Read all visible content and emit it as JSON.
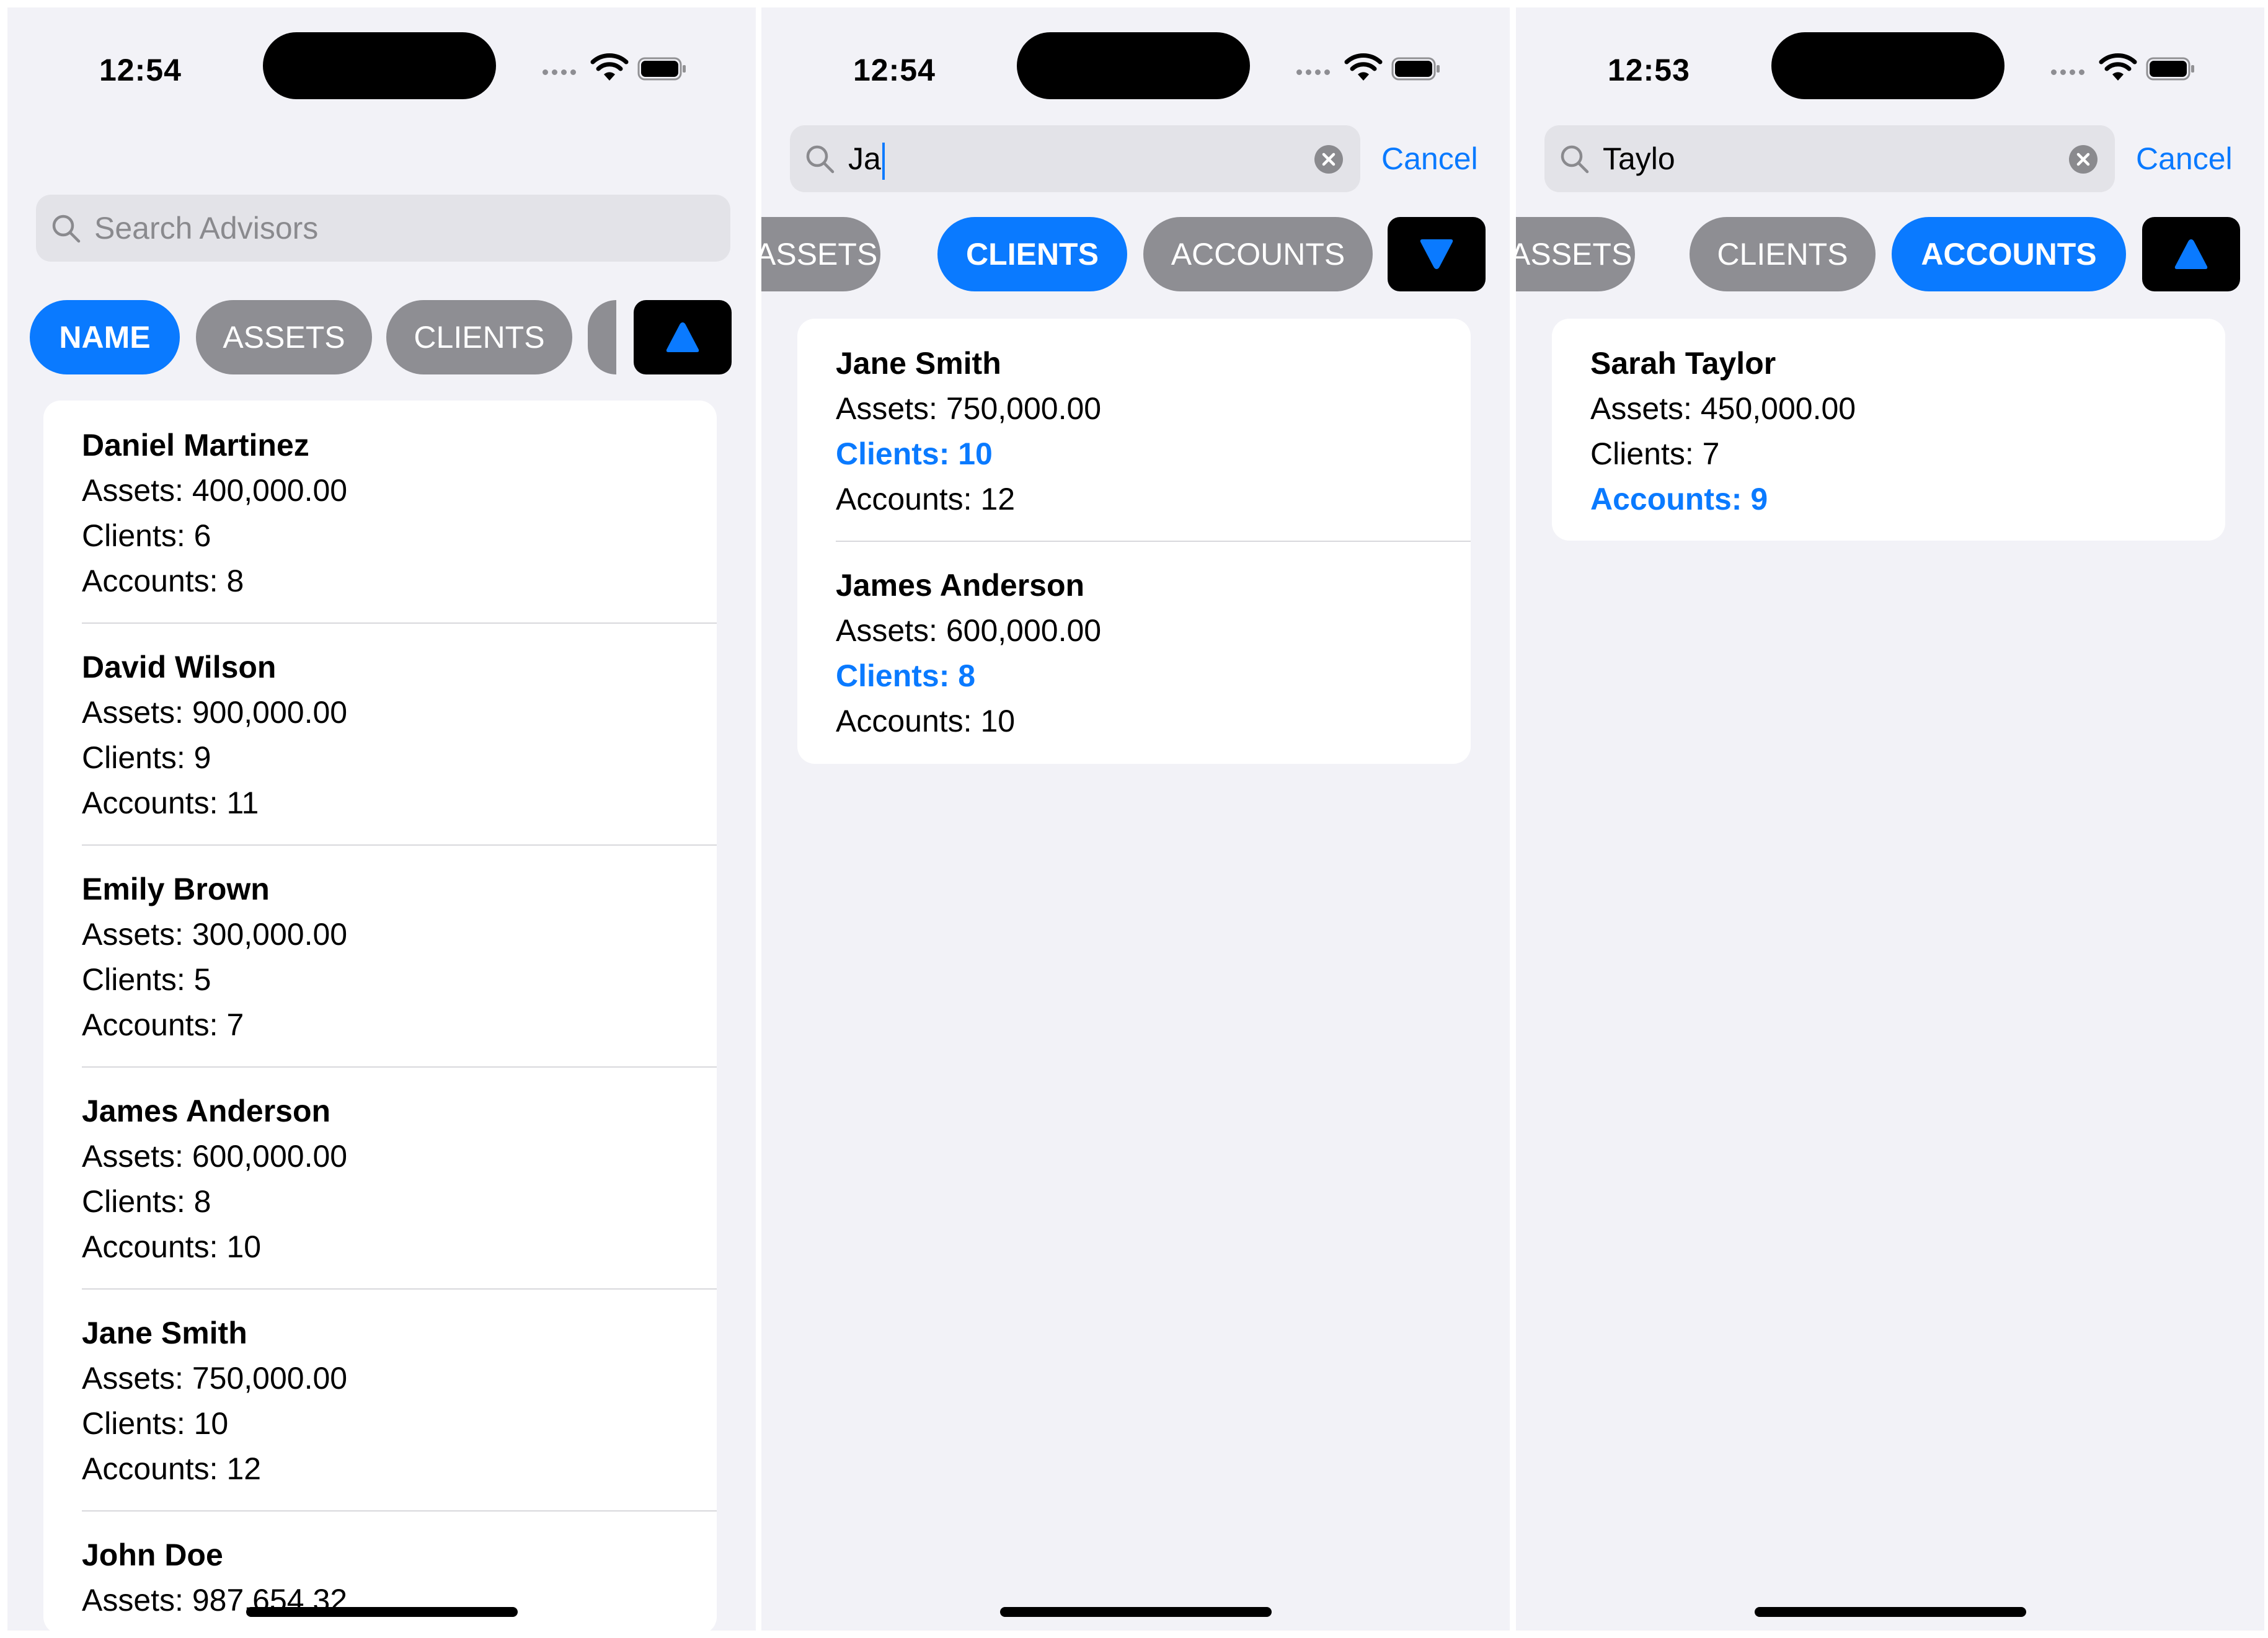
{
  "colors": {
    "accent": "#0a7aff",
    "chip_inactive": "#8e8e93",
    "background": "#f2f2f7",
    "card": "#ffffff"
  },
  "screens": [
    {
      "status": {
        "time": "12:54"
      },
      "search": {
        "value": "",
        "placeholder": "Search Advisors",
        "focused": false
      },
      "chips": [
        {
          "label": "NAME",
          "active": true
        },
        {
          "label": "ASSETS",
          "active": false
        },
        {
          "label": "CLIENTS",
          "active": false
        },
        {
          "label": "",
          "active": false
        }
      ],
      "sort_direction": "ascending",
      "sort_icon": "triangle-up-icon",
      "advisors": [
        {
          "name": "Daniel Martinez",
          "assets": "Assets: 400,000.00",
          "clients": "Clients: 6",
          "accounts": "Accounts: 8"
        },
        {
          "name": "David Wilson",
          "assets": "Assets: 900,000.00",
          "clients": "Clients: 9",
          "accounts": "Accounts: 11"
        },
        {
          "name": "Emily Brown",
          "assets": "Assets: 300,000.00",
          "clients": "Clients: 5",
          "accounts": "Accounts: 7"
        },
        {
          "name": "James Anderson",
          "assets": "Assets: 600,000.00",
          "clients": "Clients: 8",
          "accounts": "Accounts: 10"
        },
        {
          "name": "Jane Smith",
          "assets": "Assets: 750,000.00",
          "clients": "Clients: 10",
          "accounts": "Accounts: 12"
        },
        {
          "name": "John Doe",
          "assets": "Assets: 987,654.32",
          "clients": "",
          "accounts": ""
        }
      ]
    },
    {
      "status": {
        "time": "12:54"
      },
      "search": {
        "value": "Ja",
        "placeholder": "Search Advisors",
        "focused": true,
        "cancel_label": "Cancel"
      },
      "chips": [
        {
          "label": "ASSETS",
          "active": false
        },
        {
          "label": "CLIENTS",
          "active": true
        },
        {
          "label": "ACCOUNTS",
          "active": false
        }
      ],
      "sort_direction": "descending",
      "sort_icon": "triangle-down-icon",
      "advisors": [
        {
          "name": "Jane Smith",
          "assets": "Assets: 750,000.00",
          "clients": "Clients: 10",
          "accounts": "Accounts: 12"
        },
        {
          "name": "James Anderson",
          "assets": "Assets: 600,000.00",
          "clients": "Clients: 8",
          "accounts": "Accounts: 10"
        }
      ]
    },
    {
      "status": {
        "time": "12:53"
      },
      "search": {
        "value": "Taylo",
        "placeholder": "Search Advisors",
        "focused": false,
        "cancel_label": "Cancel"
      },
      "chips": [
        {
          "label": "ASSETS",
          "active": false
        },
        {
          "label": "CLIENTS",
          "active": false
        },
        {
          "label": "ACCOUNTS",
          "active": true
        }
      ],
      "sort_direction": "ascending",
      "sort_icon": "triangle-up-icon",
      "advisors": [
        {
          "name": "Sarah Taylor",
          "assets": "Assets: 450,000.00",
          "clients": "Clients: 7",
          "accounts": "Accounts: 9"
        }
      ]
    }
  ]
}
